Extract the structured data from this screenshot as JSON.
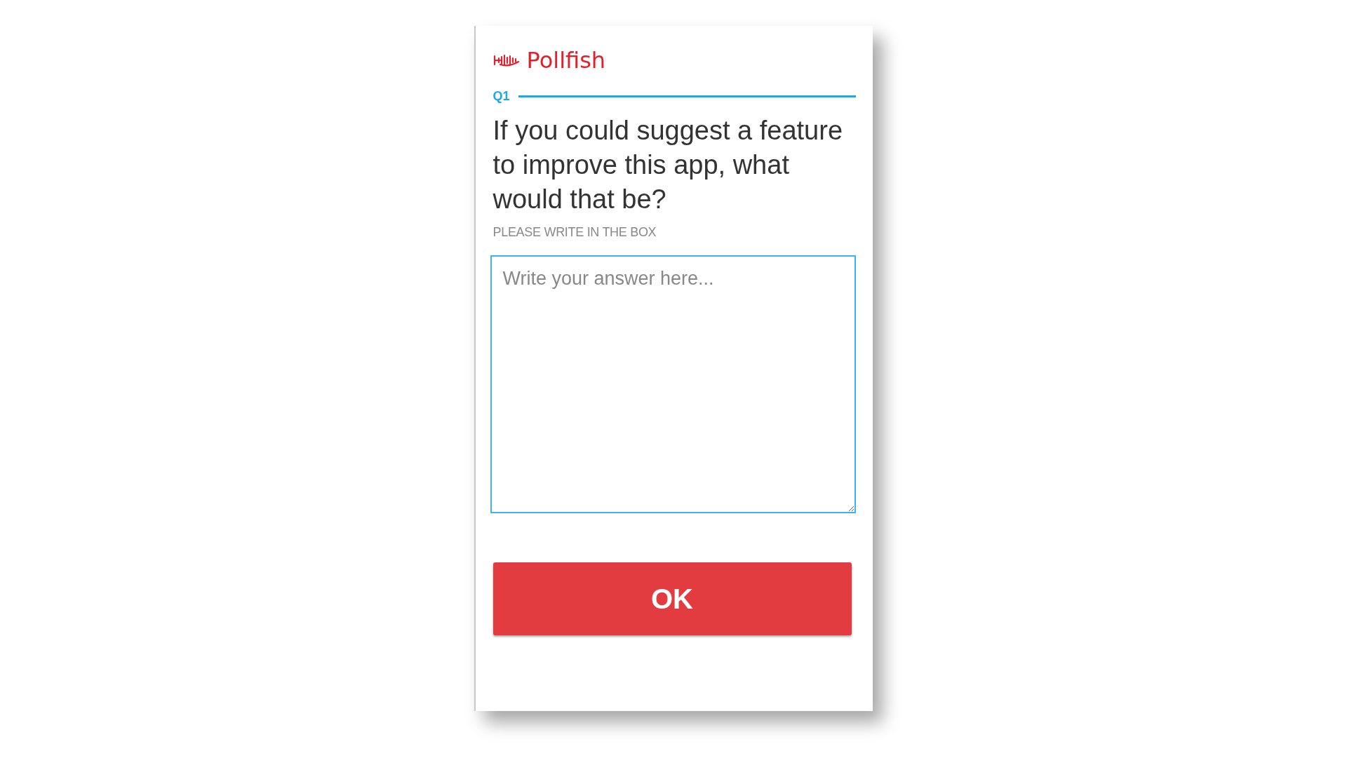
{
  "brand": {
    "name": "Pollfish"
  },
  "question": {
    "number": "Q1",
    "text": "If you could suggest a feature to improve this app, what would that be?",
    "hint": "PLEASE WRITE IN THE BOX"
  },
  "answer": {
    "placeholder": "Write your answer here..."
  },
  "buttons": [
    "OK"
  ]
}
